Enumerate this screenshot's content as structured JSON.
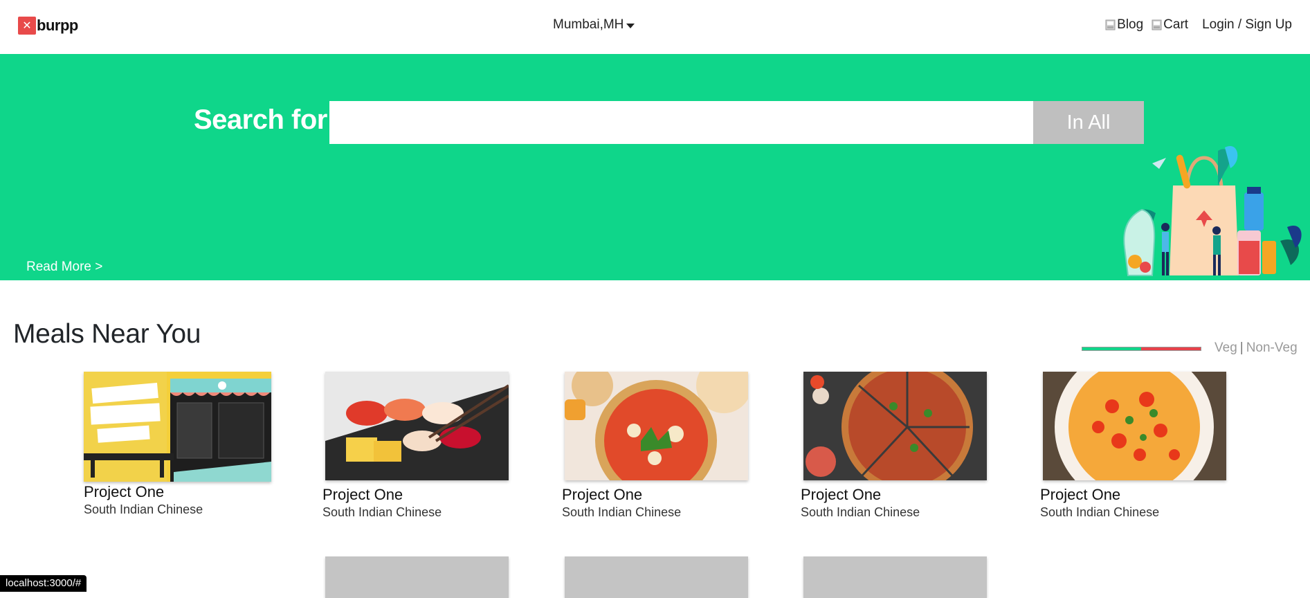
{
  "navbar": {
    "logo_text": "burpp",
    "logo_mark": "✕",
    "location": "Mumbai,MH",
    "blog_label": "Blog",
    "cart_label": "Cart",
    "auth_label": "Login / Sign Up"
  },
  "hero": {
    "search_label": "Search for",
    "search_value": "",
    "search_button": "In All",
    "read_more": "Read More >"
  },
  "meals": {
    "title": "Meals Near You",
    "filter": {
      "veg": "Veg",
      "separator": "|",
      "nonveg": "Non-Veg"
    },
    "cards": [
      {
        "title": "Project One",
        "subtitle": "South Indian Chinese"
      },
      {
        "title": "Project One",
        "subtitle": "South Indian Chinese"
      },
      {
        "title": "Project One",
        "subtitle": "South Indian Chinese"
      },
      {
        "title": "Project One",
        "subtitle": "South Indian Chinese"
      },
      {
        "title": "Project One",
        "subtitle": "South Indian Chinese"
      }
    ]
  },
  "status_bar": "localhost:3000/#",
  "colors": {
    "brand_green": "#0fd68a",
    "brand_red": "#e84a4a",
    "button_gray": "#bfbfbf"
  }
}
